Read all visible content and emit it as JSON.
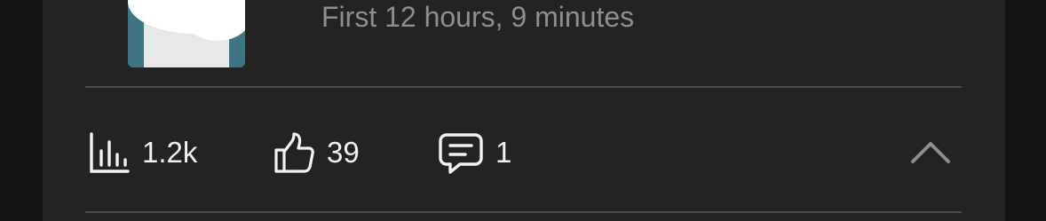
{
  "post": {
    "subtitle": "First 12 hours, 9 minutes",
    "thumbnail_icon": "post-thumbnail"
  },
  "stats": {
    "views": {
      "icon": "bar-chart-icon",
      "value": "1.2k"
    },
    "likes": {
      "icon": "thumbs-up-icon",
      "value": "39"
    },
    "comments": {
      "icon": "comment-icon",
      "value": "1"
    }
  },
  "controls": {
    "collapse_icon": "chevron-up-icon"
  },
  "colors": {
    "background": "#232323",
    "text_primary": "#f2f2f2",
    "text_secondary": "#8e8e8e",
    "divider": "#4b4b4b",
    "thumbnail_accent": "#3e7585"
  }
}
